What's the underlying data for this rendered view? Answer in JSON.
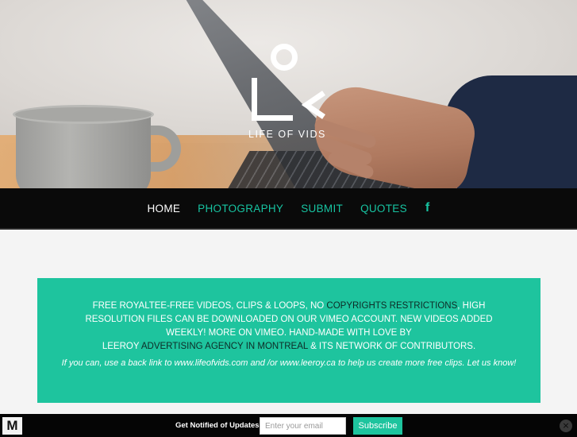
{
  "hero": {
    "logo_text": "LIFE OF VIDS"
  },
  "nav": {
    "items": [
      {
        "label": "HOME",
        "active": true
      },
      {
        "label": "PHOTOGRAPHY",
        "active": false
      },
      {
        "label": "SUBMIT",
        "active": false
      },
      {
        "label": "QUOTES",
        "active": false
      }
    ],
    "social_icon": "facebook-icon",
    "social_glyph": "f"
  },
  "banner": {
    "line1_a": "FREE ROYALTEE-FREE VIDEOS, CLIPS & LOOPS, NO ",
    "line1_link": "COPYRIGHTS RESTRICTIONS",
    "line1_b": ", HIGH RESOLUTION FILES CAN BE DOWNLOADED ON OUR VIMEO ACCOUNT. NEW VIDEOS ADDED WEEKLY! MORE ON VIMEO. HAND-MADE WITH LOVE BY",
    "line2_a": "LEEROY ",
    "line2_link": "ADVERTISING AGENCY IN MONTREAL",
    "line2_b": " & ITS NETWORK OF CONTRIBUTORS.",
    "note": "If you can, use a back link to www.lifeofvids.com and /or www.leeroy.ca to help us create more free clips. Let us know!",
    "background": "#1ec49e"
  },
  "footer_bar": {
    "badge": "M",
    "label": "Get Notified of Updates",
    "email_placeholder": "Enter your email",
    "subscribe_label": "Subscribe",
    "close_glyph": "×"
  },
  "colors": {
    "accent": "#17c3a1",
    "nav_bg": "#0a0a0a"
  }
}
